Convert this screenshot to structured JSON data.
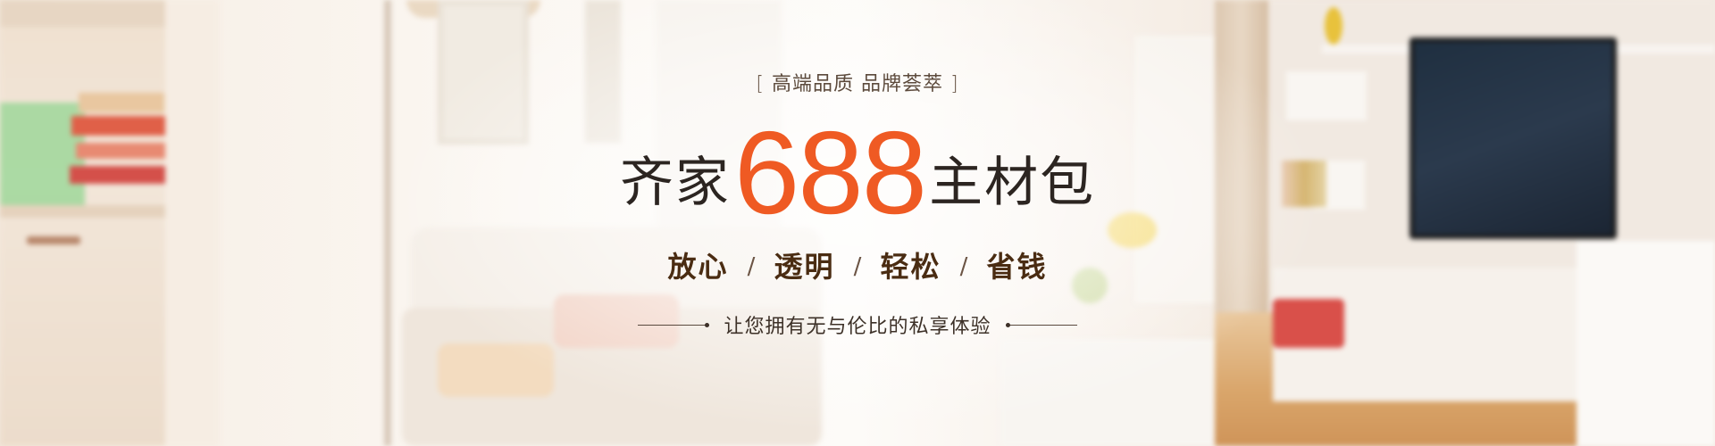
{
  "banner": {
    "tagline": {
      "open_bracket": "[",
      "text": "高端品质 品牌荟萃",
      "close_bracket": "]"
    },
    "headline": {
      "prefix": "齐家",
      "number": "688",
      "suffix": "主材包"
    },
    "features": [
      "放心",
      "透明",
      "轻松",
      "省钱"
    ],
    "feature_separator": "/",
    "subline": "让您拥有无与伦比的私享体验"
  },
  "colors": {
    "accent": "#ef5a23",
    "headline_text": "#2c2521",
    "feature_text": "#4a2c12"
  }
}
